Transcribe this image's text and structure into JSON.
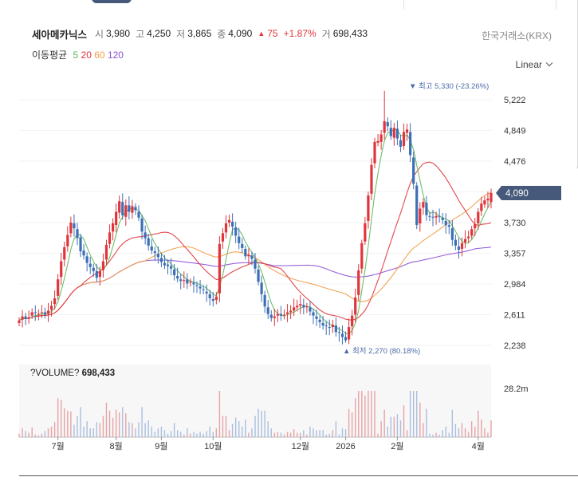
{
  "header": {
    "stock_name": "세아메카닉스",
    "open_label": "시",
    "open_value": "3,980",
    "high_label": "고",
    "high_value": "4,250",
    "low_label": "저",
    "low_value": "3,865",
    "close_label": "종",
    "close_value": "4,090",
    "change_arrow": "▲",
    "change_value": "75",
    "change_percent": "+1.87%",
    "volume_label": "거",
    "volume_value": "698,433",
    "exchange": "한국거래소(KRX)"
  },
  "moving_average": {
    "label": "이동평균",
    "periods": [
      "5",
      "20",
      "60",
      "120"
    ]
  },
  "scale_selector": {
    "label": "Linear"
  },
  "colors": {
    "up": "#e0353b",
    "down": "#3d6fb7",
    "ma5": "#5cb85c",
    "ma20": "#e0353b",
    "ma60": "#f39b46",
    "ma120": "#8d4fd6",
    "current_price_tag": "#46597a"
  },
  "annotations": {
    "max_label": "▼ 최고 5,330 (-23.26%)",
    "min_label": "▲ 최저 2,270 (80.18%)"
  },
  "current_price_tag": "4,090",
  "volume_panel": {
    "label": "?VOLUME?",
    "value": "698,433",
    "axis_label": "28.2m"
  },
  "chart_data": {
    "type": "candlestick",
    "y_ticks": [
      "5,222",
      "4,849",
      "4,476",
      "4,103",
      "3,730",
      "3,357",
      "2,984",
      "2,611",
      "2,238"
    ],
    "y_tick_values": [
      5222,
      4849,
      4476,
      4103,
      3730,
      3357,
      2984,
      2611,
      2238
    ],
    "x_ticks": [
      "7월",
      "8월",
      "9월",
      "10월",
      "12월",
      "2026",
      "2월",
      "4월"
    ],
    "x_tick_index": [
      12,
      30,
      44,
      60,
      87,
      101,
      117,
      142
    ],
    "ylim": [
      2238,
      5222
    ],
    "close": [
      2540,
      2590,
      2560,
      2580,
      2640,
      2630,
      2620,
      2640,
      2610,
      2660,
      2720,
      2810,
      3040,
      3260,
      3430,
      3580,
      3730,
      3660,
      3540,
      3380,
      3330,
      3240,
      3190,
      3140,
      3060,
      3140,
      3260,
      3460,
      3610,
      3720,
      3860,
      3990,
      3820,
      3940,
      3860,
      3930,
      3880,
      3790,
      3620,
      3540,
      3450,
      3390,
      3360,
      3310,
      3250,
      3210,
      3200,
      3170,
      3090,
      3050,
      3020,
      3030,
      2990,
      3010,
      2980,
      2960,
      2930,
      2910,
      2870,
      2810,
      2780,
      2830,
      3470,
      3600,
      3720,
      3760,
      3680,
      3570,
      3480,
      3420,
      3320,
      3340,
      3290,
      3170,
      3010,
      2860,
      2710,
      2620,
      2570,
      2590,
      2620,
      2600,
      2610,
      2640,
      2660,
      2700,
      2720,
      2740,
      2700,
      2710,
      2650,
      2600,
      2560,
      2520,
      2480,
      2470,
      2450,
      2490,
      2400,
      2390,
      2340,
      2300,
      2460,
      2600,
      2820,
      3150,
      3480,
      3720,
      4060,
      4430,
      4710,
      4720,
      4800,
      4960,
      4900,
      4780,
      4880,
      4750,
      4650,
      4830,
      4860,
      4550,
      4200,
      3700,
      3900,
      3980,
      3820,
      3800,
      3790,
      3810,
      3800,
      3760,
      3700,
      3680,
      3520,
      3450,
      3400,
      3480,
      3530,
      3560,
      3650,
      3710,
      3860,
      3960,
      4000,
      4020,
      4090
    ],
    "open": [
      2510,
      2550,
      2590,
      2560,
      2600,
      2640,
      2620,
      2630,
      2640,
      2620,
      2670,
      2740,
      2840,
      3070,
      3280,
      3440,
      3600,
      3720,
      3650,
      3550,
      3390,
      3320,
      3230,
      3180,
      3140,
      3070,
      3150,
      3280,
      3470,
      3620,
      3700,
      3850,
      3980,
      3800,
      3940,
      3850,
      3920,
      3860,
      3780,
      3610,
      3540,
      3440,
      3380,
      3350,
      3300,
      3240,
      3220,
      3200,
      3160,
      3080,
      3040,
      3020,
      3040,
      3000,
      3000,
      2970,
      2950,
      2920,
      2890,
      2860,
      2800,
      2790,
      2870,
      3500,
      3610,
      3730,
      3740,
      3670,
      3560,
      3470,
      3410,
      3320,
      3330,
      3280,
      3160,
      3000,
      2850,
      2700,
      2610,
      2570,
      2600,
      2620,
      2600,
      2620,
      2640,
      2660,
      2700,
      2720,
      2730,
      2700,
      2700,
      2640,
      2590,
      2550,
      2510,
      2480,
      2460,
      2460,
      2480,
      2400,
      2380,
      2340,
      2310,
      2470,
      2610,
      2850,
      3170,
      3500,
      3750,
      4080,
      4450,
      4700,
      4710,
      4820,
      4950,
      4880,
      4760,
      4870,
      4730,
      4660,
      4820,
      4830,
      4520,
      4180,
      3720,
      3910,
      3970,
      3810,
      3800,
      3790,
      3810,
      3790,
      3750,
      3700,
      3660,
      3520,
      3440,
      3410,
      3490,
      3540,
      3570,
      3660,
      3720,
      3870,
      3950,
      4000,
      3980
    ],
    "volume_scale_label": "28.2m"
  }
}
